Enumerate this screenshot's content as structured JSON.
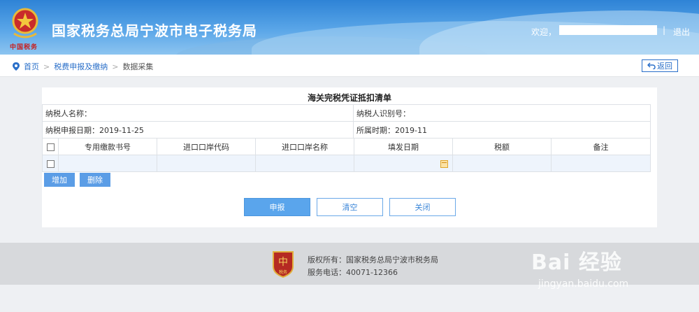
{
  "header": {
    "title": "国家税务总局宁波市电子税务局",
    "emblem_text": "中国税务",
    "welcome": "欢迎，",
    "separator": "|",
    "logout": "退出"
  },
  "breadcrumb": {
    "home": "首页",
    "level1": "税费申报及缴纳",
    "current": "数据采集",
    "arrow": ">",
    "back_button": "返回"
  },
  "form": {
    "title": "海关完税凭证抵扣清单",
    "taxpayer_name_label": "纳税人名称：",
    "taxpayer_id_label": "纳税人识别号：",
    "declare_date": "纳税申报日期：2019-11-25",
    "period": "所属时期：2019-11",
    "columns": [
      "专用缴款书号",
      "进口口岸代码",
      "进口口岸名称",
      "填发日期",
      "税额",
      "备注"
    ]
  },
  "buttons": {
    "add": "增加",
    "delete": "删除",
    "submit": "申报",
    "clear": "清空",
    "close": "关闭"
  },
  "footer": {
    "copyright": "版权所有：国家税务总局宁波市税务局",
    "phone": "服务电话：40071-12366",
    "logo_text": "税务"
  },
  "watermark": {
    "text": "Bai 经验",
    "url": "jingyan.baidu.com"
  },
  "colors": {
    "header_blue": "#2e83d6",
    "primary_button": "#5aa5ec",
    "link": "#2a6fc9"
  }
}
